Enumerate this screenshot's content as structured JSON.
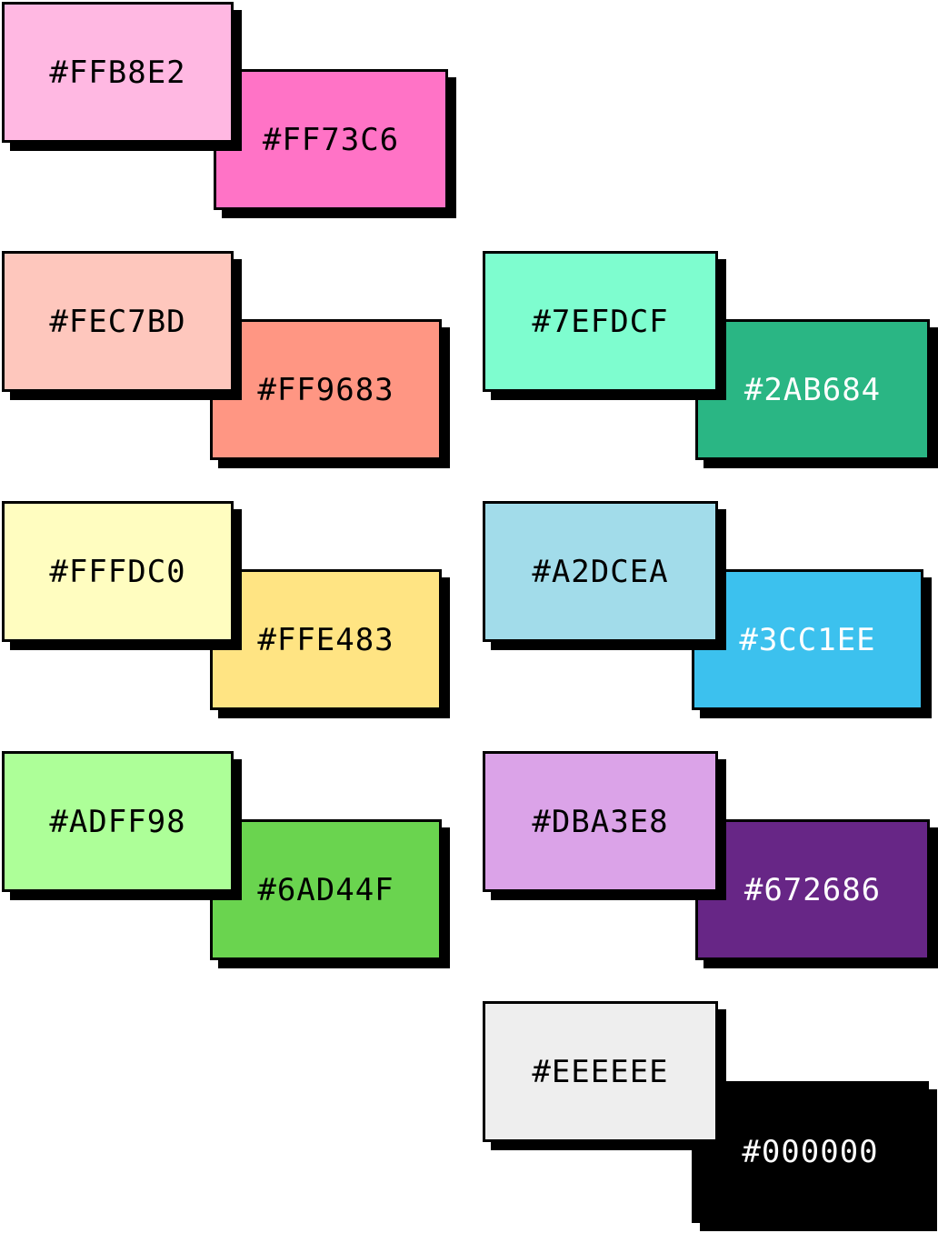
{
  "swatches": [
    {
      "id": "ffb8e2",
      "label": "#FFB8E2",
      "color": "#FFB8E2",
      "text_color": "#000000",
      "layer": "front"
    },
    {
      "id": "ff73c6",
      "label": "#FF73C6",
      "color": "#FF73C6",
      "text_color": "#000000",
      "layer": "back"
    },
    {
      "id": "fec7bd",
      "label": "#FEC7BD",
      "color": "#FEC7BD",
      "text_color": "#000000",
      "layer": "front"
    },
    {
      "id": "ff9683",
      "label": "#FF9683",
      "color": "#FF9683",
      "text_color": "#000000",
      "layer": "back"
    },
    {
      "id": "7efdcf",
      "label": "#7EFDCF",
      "color": "#7EFDCF",
      "text_color": "#000000",
      "layer": "front"
    },
    {
      "id": "2ab684",
      "label": "#2AB684",
      "color": "#2AB684",
      "text_color": "#FFFFFF",
      "layer": "back"
    },
    {
      "id": "fffdc0",
      "label": "#FFFDC0",
      "color": "#FFFDC0",
      "text_color": "#000000",
      "layer": "front"
    },
    {
      "id": "ffe483",
      "label": "#FFE483",
      "color": "#FFE483",
      "text_color": "#000000",
      "layer": "back"
    },
    {
      "id": "a2dcea",
      "label": "#A2DCEA",
      "color": "#A2DCEA",
      "text_color": "#000000",
      "layer": "front"
    },
    {
      "id": "3cc1ee",
      "label": "#3CC1EE",
      "color": "#3CC1EE",
      "text_color": "#FFFFFF",
      "layer": "back"
    },
    {
      "id": "adff98",
      "label": "#ADFF98",
      "color": "#ADFF98",
      "text_color": "#000000",
      "layer": "front"
    },
    {
      "id": "6ad44f",
      "label": "#6AD44F",
      "color": "#6AD44F",
      "text_color": "#000000",
      "layer": "back"
    },
    {
      "id": "dba3e8",
      "label": "#DBA3E8",
      "color": "#DBA3E8",
      "text_color": "#000000",
      "layer": "front"
    },
    {
      "id": "672686",
      "label": "#672686",
      "color": "#672686",
      "text_color": "#FFFFFF",
      "layer": "back"
    },
    {
      "id": "eeeeee",
      "label": "#EEEEEE",
      "color": "#EEEEEE",
      "text_color": "#000000",
      "layer": "front"
    },
    {
      "id": "000000",
      "label": "#000000",
      "color": "#000000",
      "text_color": "#FFFFFF",
      "layer": "back"
    }
  ]
}
